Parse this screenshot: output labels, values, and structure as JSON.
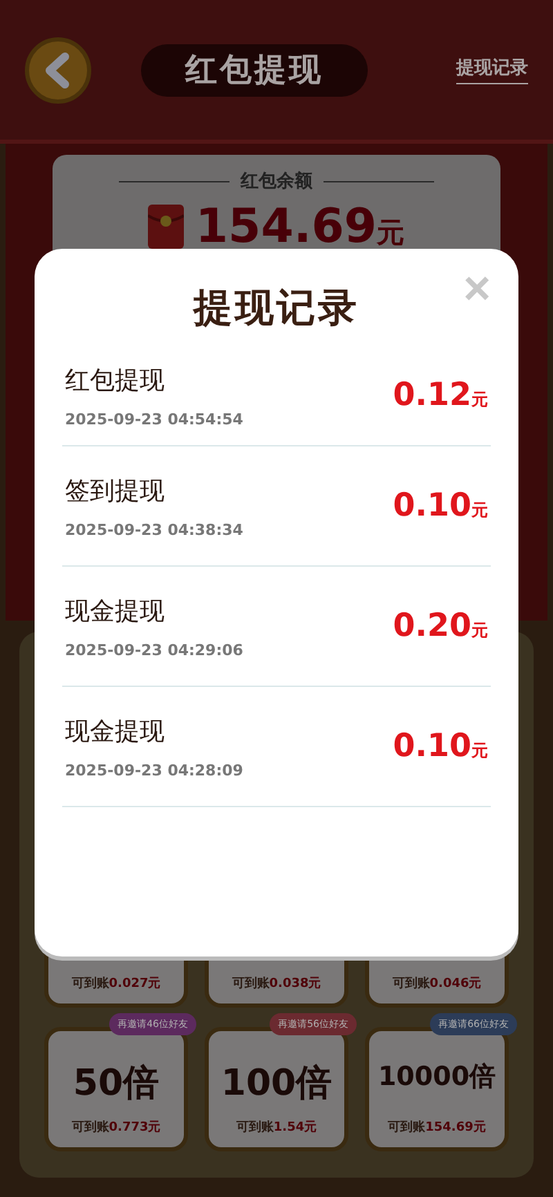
{
  "header": {
    "title": "红包提现",
    "link": "提现记录"
  },
  "balance": {
    "label": "红包余额",
    "amount": "154.69",
    "unit": "元"
  },
  "options": [
    {
      "note_prefix": "可到账",
      "note_amount": "0.027元"
    },
    {
      "note_prefix": "可到账",
      "note_amount": "0.038元"
    },
    {
      "note_prefix": "可到账",
      "note_amount": "0.046元"
    },
    {
      "multiplier": "50倍",
      "badge": "再邀请46位好友",
      "color": "#5c2a5e",
      "note_prefix": "可到账",
      "note_amount": "0.773元"
    },
    {
      "multiplier": "100倍",
      "badge": "再邀请56位好友",
      "color": "#6b2a30",
      "note_prefix": "可到账",
      "note_amount": "1.54元"
    },
    {
      "multiplier": "10000倍",
      "badge": "再邀请66位好友",
      "color": "#2c3c58",
      "note_prefix": "可到账",
      "note_amount": "154.69元"
    }
  ],
  "modal": {
    "title": "提现记录",
    "close": "×",
    "records": [
      {
        "name": "红包提现",
        "time": "2025-09-23 04:54:54",
        "amount": "0.12",
        "unit": "元"
      },
      {
        "name": "签到提现",
        "time": "2025-09-23 04:38:34",
        "amount": "0.10",
        "unit": "元"
      },
      {
        "name": "现金提现",
        "time": "2025-09-23 04:29:06",
        "amount": "0.20",
        "unit": "元"
      },
      {
        "name": "现金提现",
        "time": "2025-09-23 04:28:09",
        "amount": "0.10",
        "unit": "元"
      }
    ]
  }
}
